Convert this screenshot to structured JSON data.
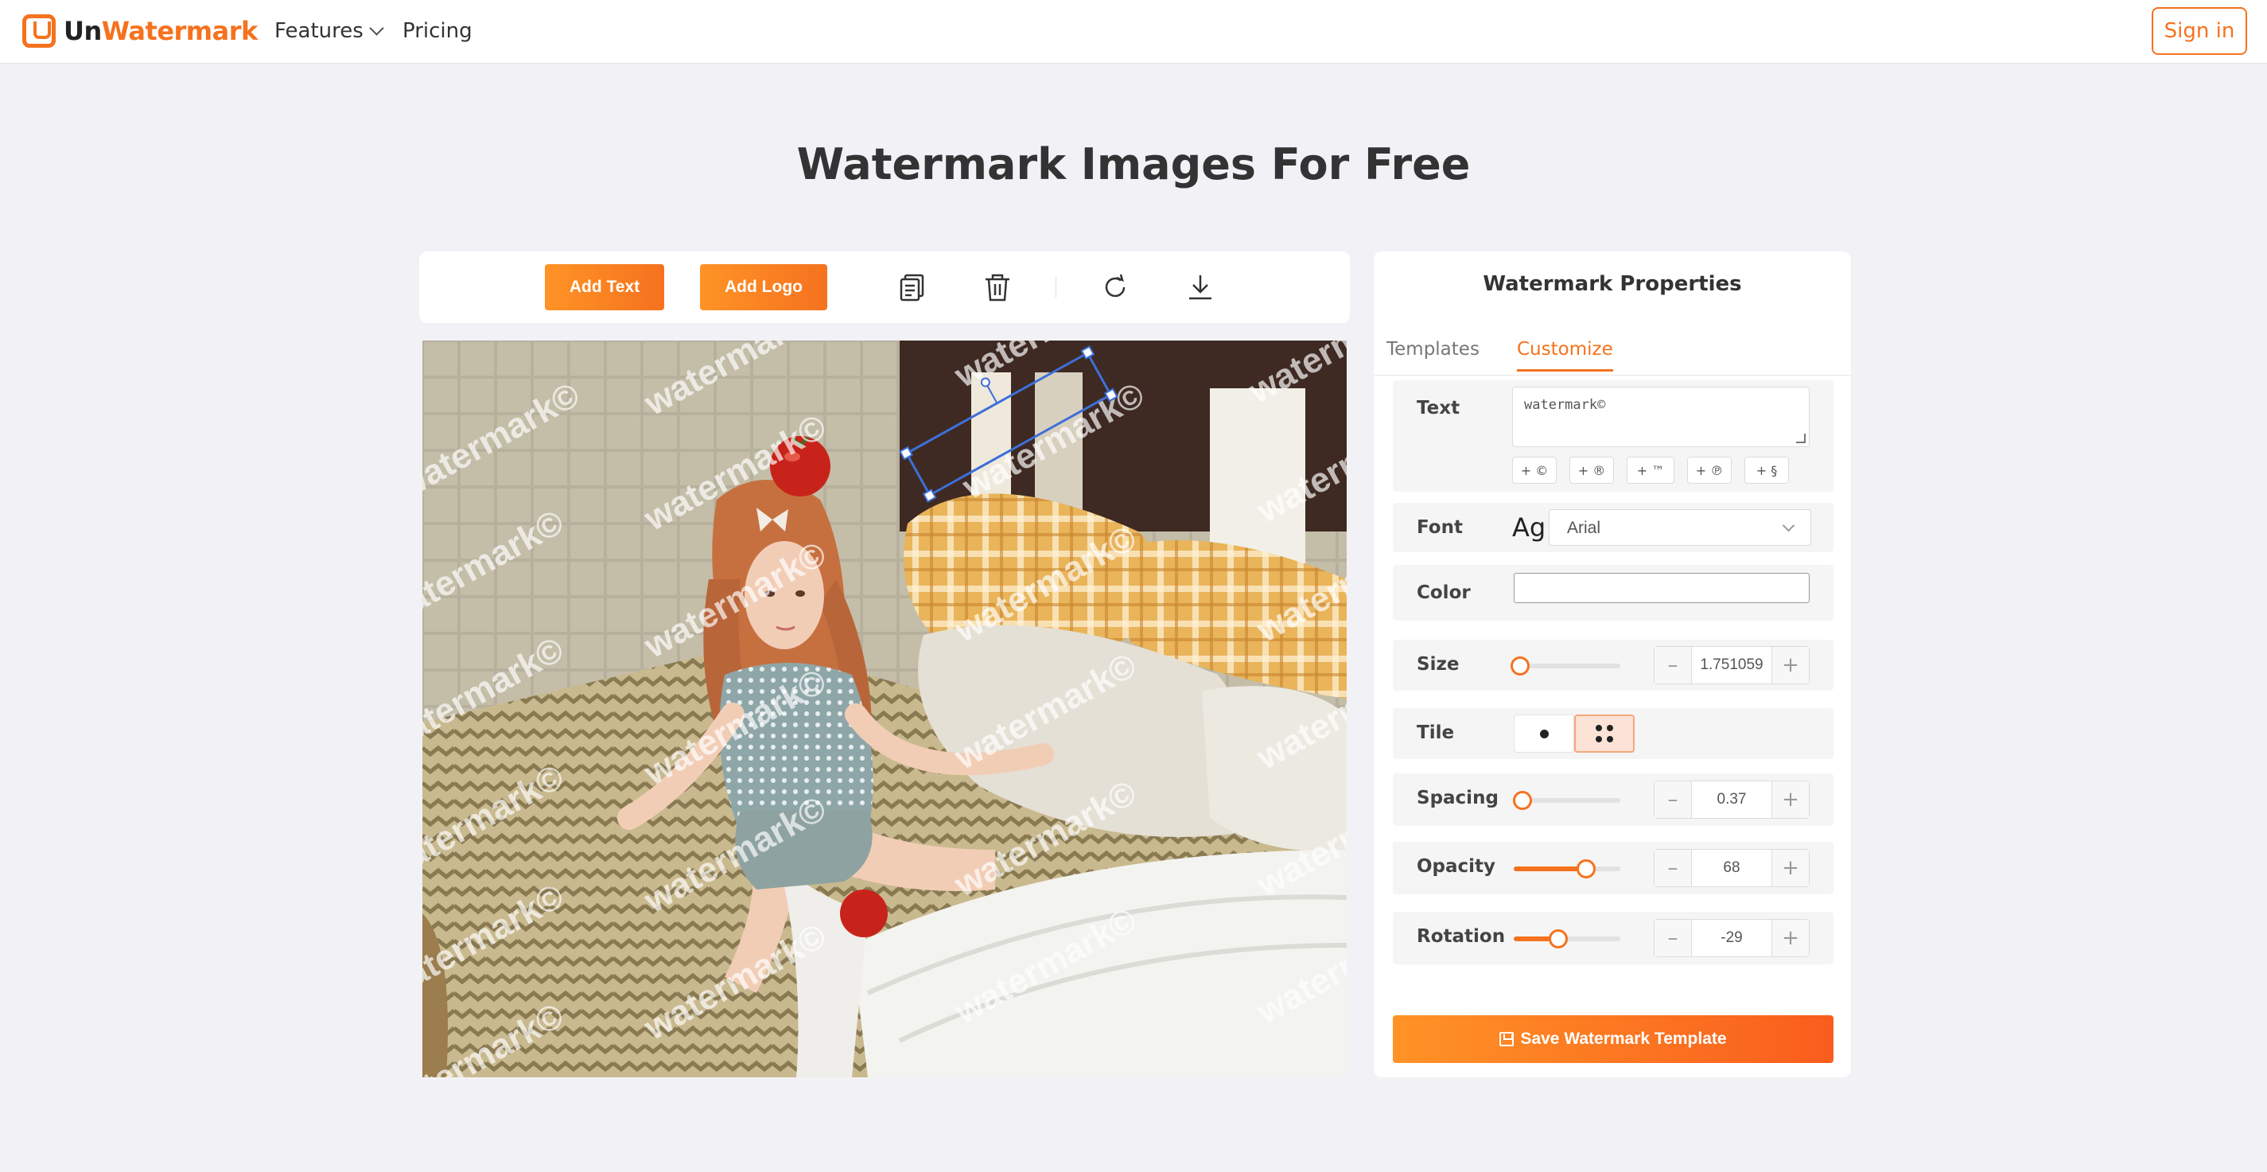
{
  "header": {
    "logo_part1": "Un",
    "logo_part2": "Watermark",
    "nav_features": "Features",
    "nav_pricing": "Pricing",
    "signin": "Sign in"
  },
  "page_title": "Watermark Images For Free",
  "toolbar": {
    "add_text": "Add Text",
    "add_logo": "Add Logo",
    "icons": [
      "copy-icon",
      "trash-icon",
      "rotate-icon",
      "download-icon"
    ]
  },
  "canvas": {
    "watermark_text": "watermark©",
    "description": "photo of a child on a bed with tiled watermark text"
  },
  "panel": {
    "title": "Watermark Properties",
    "tabs": [
      "Templates",
      "Customize"
    ],
    "active_tab": "Customize",
    "text_label": "Text",
    "text_value": "watermark©",
    "symbols": [
      "+ ©",
      "+ ®",
      "+ ™",
      "+ ℗",
      "+ §"
    ],
    "font_label": "Font",
    "font_preview": "Ag",
    "font_value": "Arial",
    "color_label": "Color",
    "color_value": "#ffffff",
    "size_label": "Size",
    "size_value": "1.751059",
    "size_level": 0.06,
    "tile_label": "Tile",
    "tile_mode": "tiled",
    "spacing_label": "Spacing",
    "spacing_value": "0.37",
    "spacing_level": 0.08,
    "opacity_label": "Opacity",
    "opacity_value": "68",
    "opacity_level": 0.68,
    "rotation_label": "Rotation",
    "rotation_value": "-29",
    "rotation_level": 0.42,
    "minus": "–",
    "plus": "+",
    "save_button": "Save Watermark Template"
  },
  "colors": {
    "accent": "#f5721e",
    "background": "#f2f2f6",
    "selection": "#3d6fd9"
  }
}
